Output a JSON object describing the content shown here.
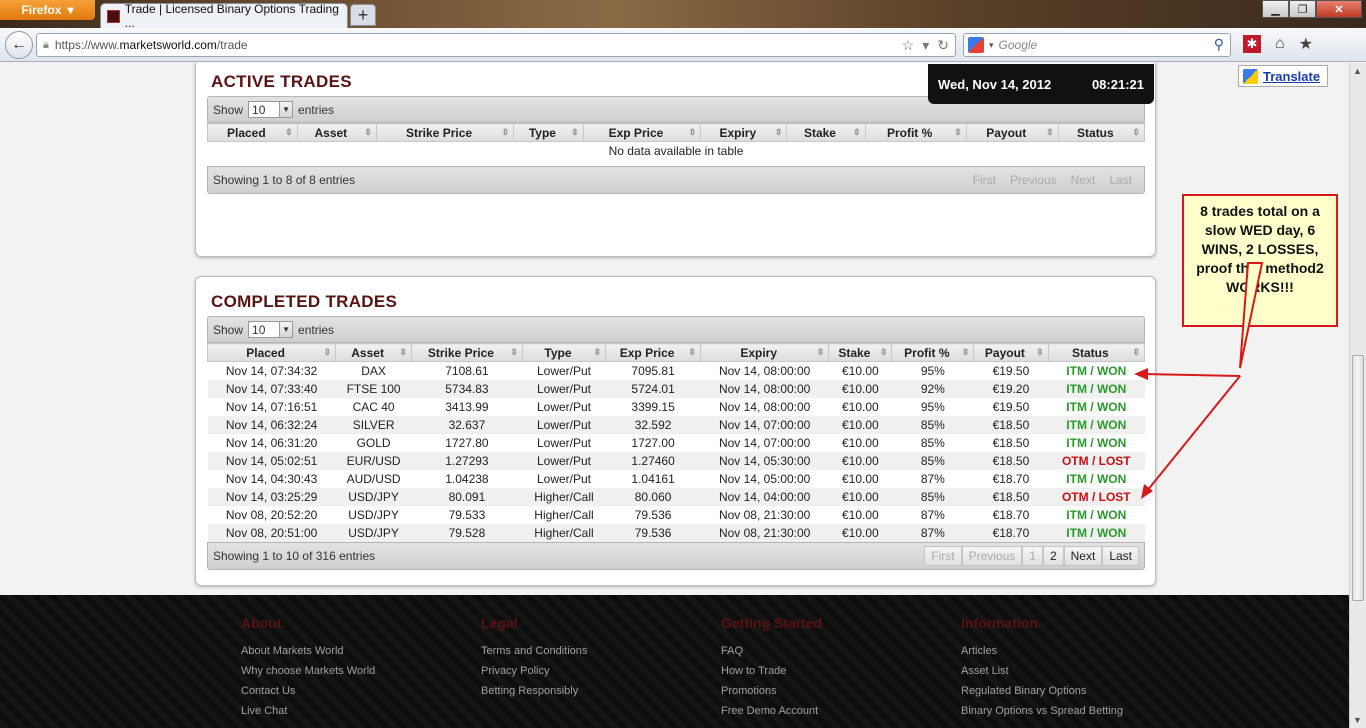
{
  "browser": {
    "app_button": "Firefox",
    "tab_title": "Trade | Licensed Binary Options Trading ...",
    "url_prefix": "https://www.",
    "url_domain": "marketsworld.com",
    "url_path": "/trade",
    "search_placeholder": "Google"
  },
  "clock": {
    "date": "Wed, Nov 14, 2012",
    "time": "08:21:21"
  },
  "translate_label": "Translate",
  "active": {
    "title": "ACTIVE TRADES",
    "show_label": "Show",
    "entries_label": "entries",
    "page_size": "10",
    "columns": [
      "Placed",
      "Asset",
      "Strike Price",
      "Type",
      "Exp Price",
      "Expiry",
      "Stake",
      "Profit %",
      "Payout",
      "Status"
    ],
    "empty_text": "No data available in table",
    "info": "Showing 1 to 8 of 8 entries",
    "pager": [
      "First",
      "Previous",
      "Next",
      "Last"
    ]
  },
  "completed": {
    "title": "COMPLETED TRADES",
    "show_label": "Show",
    "entries_label": "entries",
    "page_size": "10",
    "columns": [
      "Placed",
      "Asset",
      "Strike Price",
      "Type",
      "Exp Price",
      "Expiry",
      "Stake",
      "Profit %",
      "Payout",
      "Status"
    ],
    "rows": [
      [
        "Nov 14, 07:34:32",
        "DAX",
        "7108.61",
        "Lower/Put",
        "7095.81",
        "Nov 14, 08:00:00",
        "€10.00",
        "95%",
        "€19.50",
        "ITM / WON"
      ],
      [
        "Nov 14, 07:33:40",
        "FTSE 100",
        "5734.83",
        "Lower/Put",
        "5724.01",
        "Nov 14, 08:00:00",
        "€10.00",
        "92%",
        "€19.20",
        "ITM / WON"
      ],
      [
        "Nov 14, 07:16:51",
        "CAC 40",
        "3413.99",
        "Lower/Put",
        "3399.15",
        "Nov 14, 08:00:00",
        "€10.00",
        "95%",
        "€19.50",
        "ITM / WON"
      ],
      [
        "Nov 14, 06:32:24",
        "SILVER",
        "32.637",
        "Lower/Put",
        "32.592",
        "Nov 14, 07:00:00",
        "€10.00",
        "85%",
        "€18.50",
        "ITM / WON"
      ],
      [
        "Nov 14, 06:31:20",
        "GOLD",
        "1727.80",
        "Lower/Put",
        "1727.00",
        "Nov 14, 07:00:00",
        "€10.00",
        "85%",
        "€18.50",
        "ITM / WON"
      ],
      [
        "Nov 14, 05:02:51",
        "EUR/USD",
        "1.27293",
        "Lower/Put",
        "1.27460",
        "Nov 14, 05:30:00",
        "€10.00",
        "85%",
        "€18.50",
        "OTM / LOST"
      ],
      [
        "Nov 14, 04:30:43",
        "AUD/USD",
        "1.04238",
        "Lower/Put",
        "1.04161",
        "Nov 14, 05:00:00",
        "€10.00",
        "87%",
        "€18.70",
        "ITM / WON"
      ],
      [
        "Nov 14, 03:25:29",
        "USD/JPY",
        "80.091",
        "Higher/Call",
        "80.060",
        "Nov 14, 04:00:00",
        "€10.00",
        "85%",
        "€18.50",
        "OTM / LOST"
      ],
      [
        "Nov 08, 20:52:20",
        "USD/JPY",
        "79.533",
        "Higher/Call",
        "79.536",
        "Nov 08, 21:30:00",
        "€10.00",
        "87%",
        "€18.70",
        "ITM / WON"
      ],
      [
        "Nov 08, 20:51:00",
        "USD/JPY",
        "79.528",
        "Higher/Call",
        "79.536",
        "Nov 08, 21:30:00",
        "€10.00",
        "87%",
        "€18.70",
        "ITM / WON"
      ]
    ],
    "info": "Showing 1 to 10 of 316 entries",
    "pager": [
      "First",
      "Previous",
      "1",
      "2",
      "Next",
      "Last"
    ]
  },
  "annotation": "8 trades total on a slow WED day, 6 WINS, 2 LOSSES, proof that method2 WORKS!!!",
  "colors": {
    "won": "#2a9a2a",
    "lost": "#c81010",
    "title": "#5a1313",
    "annotation_border": "#d81818"
  },
  "footer": {
    "columns": [
      {
        "title": "About",
        "links": [
          "About Markets World",
          "Why choose Markets World",
          "Contact Us",
          "Live Chat"
        ]
      },
      {
        "title": "Legal",
        "links": [
          "Terms and Conditions",
          "Privacy Policy",
          "Betting Responsibly"
        ]
      },
      {
        "title": "Getting Started",
        "links": [
          "FAQ",
          "How to Trade",
          "Promotions",
          "Free Demo Account"
        ]
      },
      {
        "title": "Information",
        "links": [
          "Articles",
          "Asset List",
          "Regulated Binary Options",
          "Binary Options vs Spread Betting"
        ]
      }
    ]
  }
}
